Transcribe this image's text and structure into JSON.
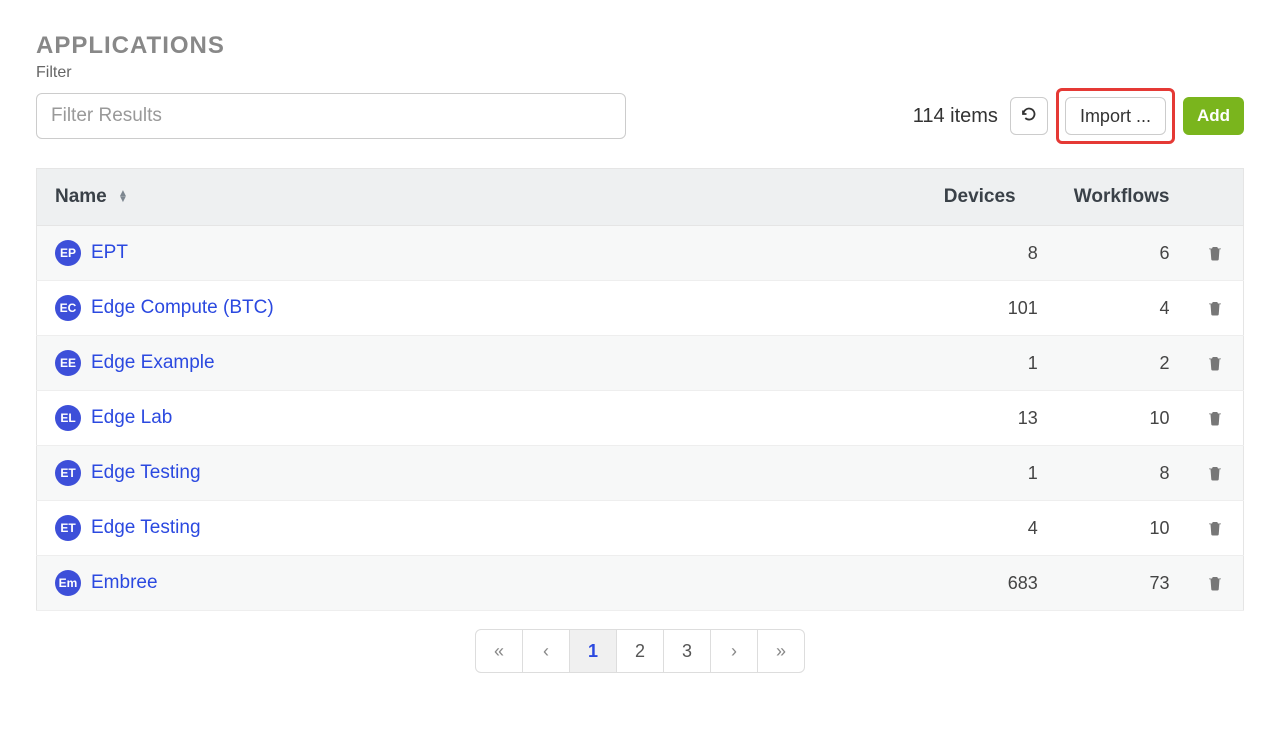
{
  "header": {
    "title": "APPLICATIONS",
    "filter_label": "Filter",
    "filter_placeholder": "Filter Results"
  },
  "toolbar": {
    "item_count": "114 items",
    "refresh_label": "↻",
    "import_label": "Import ...",
    "add_label": "Add"
  },
  "table": {
    "columns": {
      "name": "Name",
      "devices": "Devices",
      "workflows": "Workflows"
    },
    "rows": [
      {
        "initials": "EP",
        "name": "EPT",
        "devices": 8,
        "workflows": 6
      },
      {
        "initials": "EC",
        "name": "Edge Compute (BTC)",
        "devices": 101,
        "workflows": 4
      },
      {
        "initials": "EE",
        "name": "Edge Example",
        "devices": 1,
        "workflows": 2
      },
      {
        "initials": "EL",
        "name": "Edge Lab",
        "devices": 13,
        "workflows": 10
      },
      {
        "initials": "ET",
        "name": "Edge Testing",
        "devices": 1,
        "workflows": 8
      },
      {
        "initials": "ET",
        "name": "Edge Testing",
        "devices": 4,
        "workflows": 10
      },
      {
        "initials": "Em",
        "name": "Embree",
        "devices": 683,
        "workflows": 73
      }
    ]
  },
  "pagination": {
    "first": "«",
    "prev": "‹",
    "pages": [
      "1",
      "2",
      "3"
    ],
    "next": "›",
    "last": "»",
    "current": "1"
  },
  "colors": {
    "accent_blue": "#2b49e0",
    "avatar_bg": "#3d4fd9",
    "add_green": "#7ab51d",
    "highlight_red": "#e53935"
  }
}
